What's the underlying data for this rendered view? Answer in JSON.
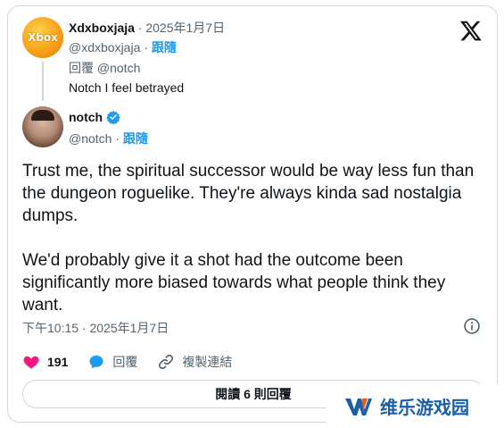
{
  "reply": {
    "avatar_text": "Xbox",
    "display_name": "Xdxboxjaja",
    "meta": " · 2025年1月7日",
    "handle": "@xdxboxjaja",
    "separator": " · ",
    "follow": "跟隨",
    "replying_to": "回覆 @notch",
    "text": "Notch I feel betrayed"
  },
  "main": {
    "display_name": "notch",
    "handle": "@notch",
    "separator": " · ",
    "follow": "跟隨",
    "paragraphs": [
      "Trust me, the spiritual successor would be way less fun than the dungeon roguelike. They're always kinda sad nostalgia dumps.",
      "We'd probably give it a shot had the outcome been significantly more biased towards what people think they want."
    ],
    "timestamp": "下午10:15 · 2025年1月7日"
  },
  "actions": {
    "likes": "191",
    "reply": "回覆",
    "copy_link": "複製連結"
  },
  "read_replies": "閱讀 6 則回覆",
  "watermark": "维乐游戏园",
  "colors": {
    "accent": "#1d9bf0",
    "like": "#f91880",
    "muted": "#536471",
    "border": "#cfd9de"
  },
  "icons": [
    "x-logo-icon",
    "verified-badge-icon",
    "info-icon",
    "heart-icon",
    "reply-bubble-icon",
    "link-icon"
  ]
}
